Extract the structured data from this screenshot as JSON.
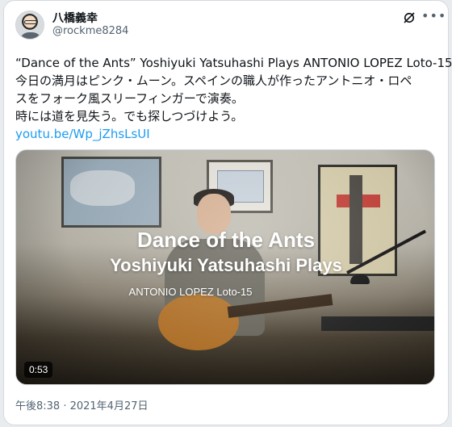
{
  "author": {
    "name": "八橋義幸",
    "handle": "@rockme8284"
  },
  "tweet": {
    "lines": [
      "“Dance of the Ants” Yoshiyuki Yatsuhashi Plays ANTONIO LOPEZ Loto-15",
      "今日の満月はピンク・ムーン。スペインの職人が作ったアントニオ・ロペ",
      "スをフォーク風スリーフィンガーで演奏。",
      "時には道を見失う。でも探しつづけよう。"
    ],
    "link": "youtu.be/Wp_jZhsLsUI"
  },
  "media": {
    "title_line1": "Dance of the Ants",
    "title_line2": "Yoshiyuki Yatsuhashi Plays",
    "title_line3": "ANTONIO  LOPEZ Loto-15",
    "duration": "0:53"
  },
  "timestamp": "午後8:38 · 2021年4月27日",
  "icons": {
    "brand": "x-logo-icon",
    "menu": "more-horizontal-icon"
  },
  "colors": {
    "link": "#1d9bf0",
    "text": "#0f1419",
    "muted": "#536471"
  }
}
